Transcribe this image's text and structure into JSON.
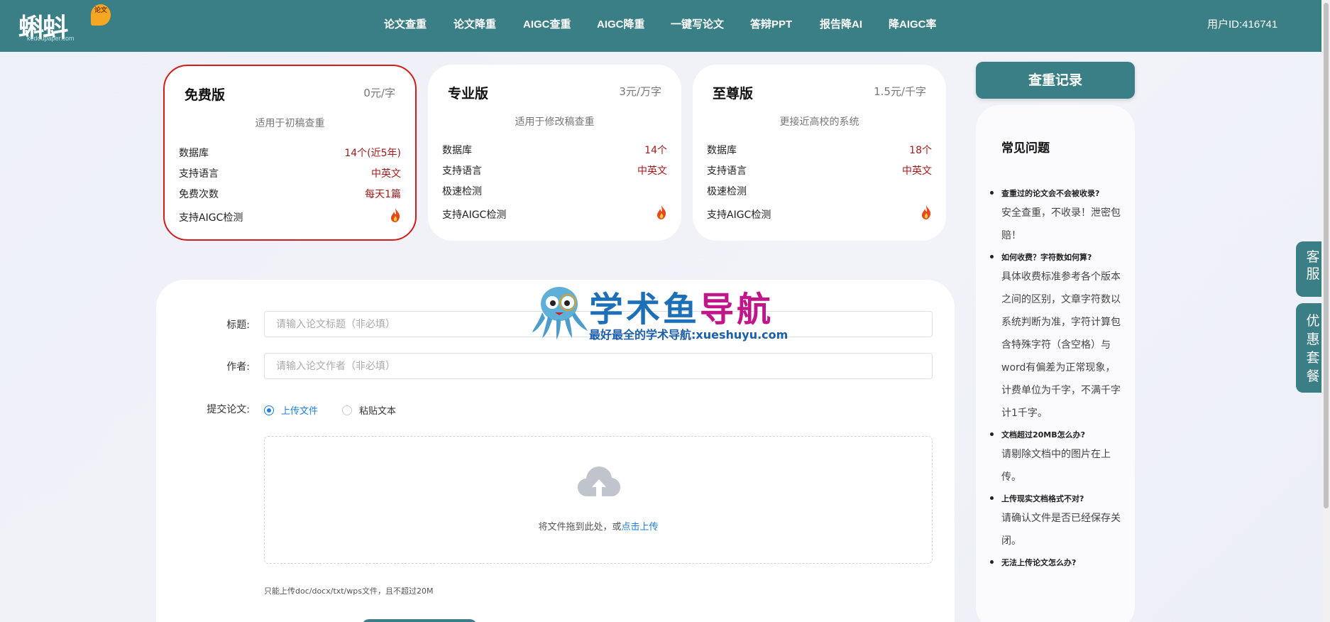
{
  "header": {
    "logo_text": "蝌蚪",
    "logo_badge": "论文",
    "logo_sub": "kedoupaper.com",
    "nav": [
      "论文查重",
      "论文降重",
      "AIGC查重",
      "AIGC降重",
      "一键写论文",
      "答辩PPT",
      "报告降AI",
      "降AIGC率"
    ],
    "user_id": "用户ID:416741"
  },
  "plans": [
    {
      "title": "免费版",
      "price": "0元/字",
      "desc": "适用于初稿查重",
      "rows": [
        {
          "label": "数据库",
          "value": "14个(近5年)"
        },
        {
          "label": "支持语言",
          "value": "中英文"
        },
        {
          "label": "免费次数",
          "value": "每天1篇"
        },
        {
          "label": "支持AIGC检测",
          "value": ""
        }
      ]
    },
    {
      "title": "专业版",
      "price": "3元/万字",
      "desc": "适用于修改稿查重",
      "rows": [
        {
          "label": "数据库",
          "value": "14个"
        },
        {
          "label": "支持语言",
          "value": "中英文"
        },
        {
          "label": "极速检测",
          "value": ""
        },
        {
          "label": "支持AIGC检测",
          "value": ""
        }
      ]
    },
    {
      "title": "至尊版",
      "price": "1.5元/千字",
      "desc": "更接近高校的系统",
      "rows": [
        {
          "label": "数据库",
          "value": "18个"
        },
        {
          "label": "支持语言",
          "value": "中英文"
        },
        {
          "label": "极速检测",
          "value": ""
        },
        {
          "label": "支持AIGC检测",
          "value": ""
        }
      ]
    }
  ],
  "sidebar": {
    "record_button": "查重记录",
    "faq_title": "常见问题",
    "faqs": [
      {
        "q": "查重过的论文会不会被收录?",
        "a": "安全查重，不收录！泄密包赔！"
      },
      {
        "q": "如何收费？字符数如何算?",
        "a": "具体收费标准参考各个版本之间的区别，文章字符数以系统判断为准，字符计算包含特殊字符（含空格）与word有偏差为正常现象，计费单位为千字，不满千字计1千字。"
      },
      {
        "q": "文档超过20MB怎么办?",
        "a": "请剔除文档中的图片在上传。"
      },
      {
        "q": "上传现实文档格式不对?",
        "a": "请确认文件是否已经保存关闭。"
      },
      {
        "q": "无法上传论文怎么办?",
        "a": ""
      }
    ]
  },
  "side_tabs": [
    "客服",
    "优惠套餐"
  ],
  "form": {
    "title_label": "标题:",
    "title_placeholder": "请输入论文标题（非必填）",
    "author_label": "作者:",
    "author_placeholder": "请输入论文作者（非必填）",
    "submit_label": "提交论文:",
    "radio_upload": "上传文件",
    "radio_paste": "粘贴文本",
    "drop_text": "将文件拖到此处，或",
    "drop_link": "点击上传",
    "hint": "只能上传doc/docx/txt/wps文件，且不超过20M"
  },
  "watermark": {
    "title_a": "学术鱼",
    "title_b": "导航",
    "sub": "最好最全的学术导航:xueshuyu.com"
  },
  "colors": {
    "brand": "#3a7e86",
    "accent_red": "#d21c1c",
    "link_blue": "#1f7fe0"
  }
}
